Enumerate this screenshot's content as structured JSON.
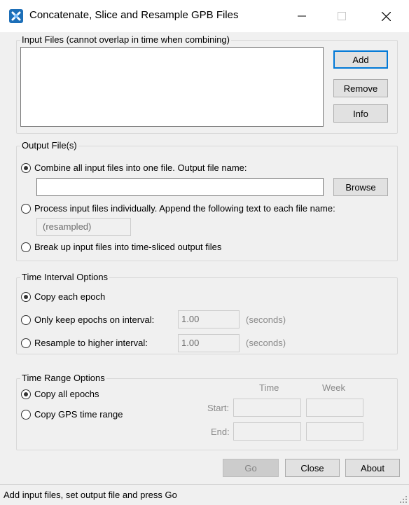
{
  "window": {
    "title": "Concatenate, Slice and Resample GPB Files",
    "icon": "app-icon",
    "minimize_icon": "minimize-icon",
    "maximize_icon": "maximize-icon",
    "close_icon": "close-icon"
  },
  "input_files": {
    "legend": "Input Files (cannot overlap in time when combining)",
    "files": [],
    "add_label": "Add",
    "remove_label": "Remove",
    "info_label": "Info"
  },
  "output_files": {
    "legend": "Output File(s)",
    "combine_label": "Combine all input files into one file. Output file name:",
    "combine_selected": true,
    "output_name_value": "",
    "browse_label": "Browse",
    "individual_label": "Process input files individually. Append the following text to each file name:",
    "individual_selected": false,
    "append_text_placeholder": "(resampled)",
    "slice_label": "Break up input files into time-sliced output files",
    "slice_selected": false
  },
  "time_interval": {
    "legend": "Time Interval Options",
    "copy_each_label": "Copy each epoch",
    "copy_each_selected": true,
    "keep_on_interval_label": "Only keep epochs on interval:",
    "keep_on_interval_value": "1.00",
    "keep_unit": "(seconds)",
    "resample_label": "Resample to higher interval:",
    "resample_value": "1.00",
    "resample_unit": "(seconds)"
  },
  "time_range": {
    "legend": "Time Range Options",
    "copy_all_label": "Copy all epochs",
    "copy_all_selected": true,
    "copy_gps_label": "Copy GPS time range",
    "time_header": "Time",
    "week_header": "Week",
    "start_label": "Start:",
    "end_label": "End:",
    "start_time": "",
    "start_week": "",
    "end_time": "",
    "end_week": ""
  },
  "actions": {
    "go_label": "Go",
    "close_label": "Close",
    "about_label": "About"
  },
  "status": {
    "text": "Add input files, set output file and press Go"
  }
}
